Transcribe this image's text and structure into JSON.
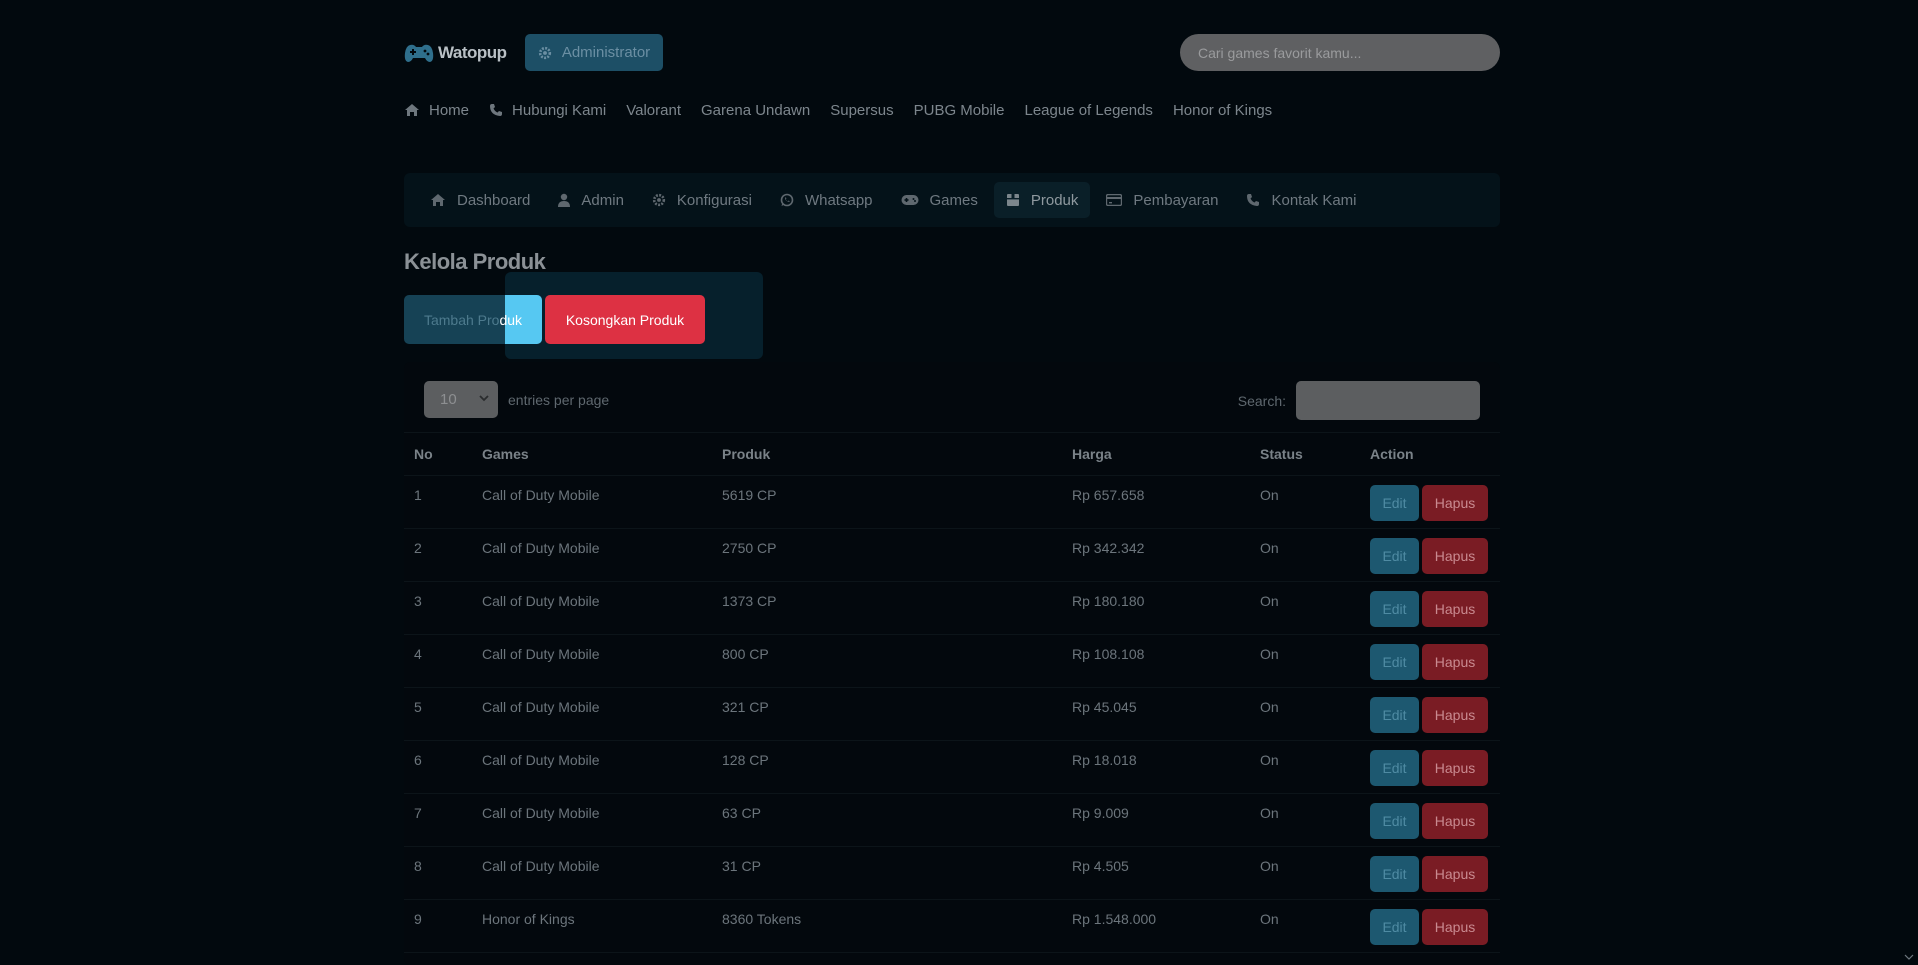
{
  "brand": {
    "name": "Watopup"
  },
  "header": {
    "admin_label": "Administrator",
    "search_placeholder": "Cari games favorit kamu..."
  },
  "main_nav": [
    {
      "label": "Home",
      "icon": "home-icon"
    },
    {
      "label": "Hubungi Kami",
      "icon": "phone-icon"
    },
    {
      "label": "Valorant"
    },
    {
      "label": "Garena Undawn"
    },
    {
      "label": "Supersus"
    },
    {
      "label": "PUBG Mobile"
    },
    {
      "label": "League of Legends"
    },
    {
      "label": "Honor of Kings"
    }
  ],
  "admin_nav": [
    {
      "label": "Dashboard",
      "icon": "home-icon"
    },
    {
      "label": "Admin",
      "icon": "user-icon"
    },
    {
      "label": "Konfigurasi",
      "icon": "gear-icon"
    },
    {
      "label": "Whatsapp",
      "icon": "whatsapp-icon"
    },
    {
      "label": "Games",
      "icon": "gamepad-icon"
    },
    {
      "label": "Produk",
      "icon": "box-icon",
      "active": true
    },
    {
      "label": "Pembayaran",
      "icon": "card-icon"
    },
    {
      "label": "Kontak Kami",
      "icon": "phone-icon"
    }
  ],
  "page": {
    "title": "Kelola Produk",
    "add_button": "Tambah Produk",
    "add_button_parts": [
      "Tambah Pro",
      "duk"
    ],
    "empty_button": "Kosongkan Produk"
  },
  "table_controls": {
    "page_size": "10",
    "entries_label": "entries per page",
    "search_label": "Search:"
  },
  "table": {
    "columns": [
      "No",
      "Games",
      "Produk",
      "Harga",
      "Status",
      "Action"
    ],
    "rows": [
      [
        "1",
        "Call of Duty Mobile",
        "5619 CP",
        "Rp 657.658",
        "On"
      ],
      [
        "2",
        "Call of Duty Mobile",
        "2750 CP",
        "Rp 342.342",
        "On"
      ],
      [
        "3",
        "Call of Duty Mobile",
        "1373 CP",
        "Rp 180.180",
        "On"
      ],
      [
        "4",
        "Call of Duty Mobile",
        "800 CP",
        "Rp 108.108",
        "On"
      ],
      [
        "5",
        "Call of Duty Mobile",
        "321 CP",
        "Rp 45.045",
        "On"
      ],
      [
        "6",
        "Call of Duty Mobile",
        "128 CP",
        "Rp 18.018",
        "On"
      ],
      [
        "7",
        "Call of Duty Mobile",
        "63 CP",
        "Rp 9.009",
        "On"
      ],
      [
        "8",
        "Call of Duty Mobile",
        "31 CP",
        "Rp 4.505",
        "On"
      ],
      [
        "9",
        "Honor of Kings",
        "8360 Tokens",
        "Rp 1.548.000",
        "On"
      ]
    ],
    "edit_label": "Edit",
    "delete_label": "Hapus"
  },
  "colors": {
    "background": "#02090e",
    "accent": "#1d4f66",
    "danger": "#dd3143",
    "highlight": "#56c8f2"
  }
}
